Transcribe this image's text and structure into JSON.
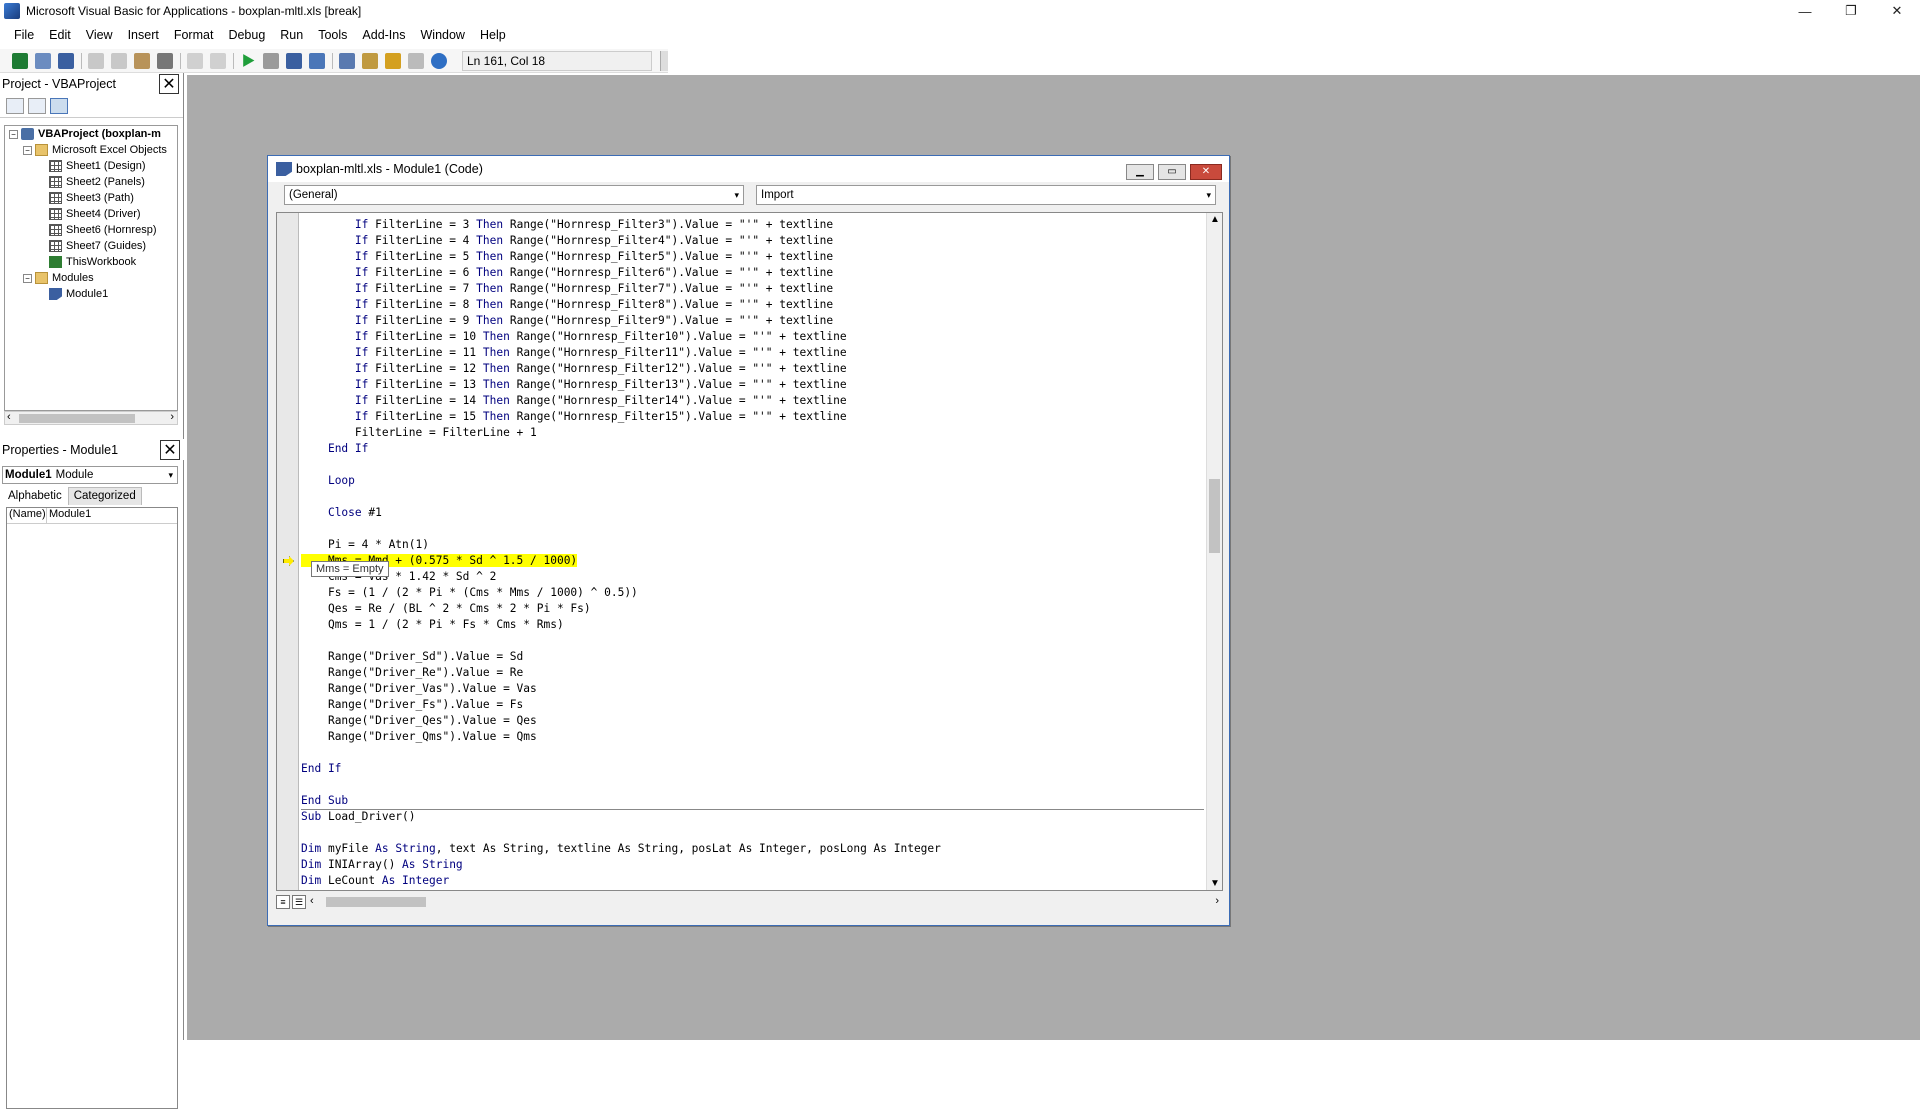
{
  "app": {
    "title": "Microsoft Visual Basic for Applications - boxplan-mltl.xls [break]",
    "window_controls": [
      "—",
      "❐",
      "✕"
    ]
  },
  "menu": [
    "File",
    "Edit",
    "View",
    "Insert",
    "Format",
    "Debug",
    "Run",
    "Tools",
    "Add-Ins",
    "Window",
    "Help"
  ],
  "toolbar": {
    "position_text": "Ln 161, Col 18"
  },
  "project": {
    "header": "Project - VBAProject",
    "close": "✕",
    "tree": [
      {
        "label": "VBAProject (boxplan-m",
        "level": 0,
        "toggle": "−",
        "icon": "project-icon",
        "bold": true
      },
      {
        "label": "Microsoft Excel Objects",
        "level": 1,
        "toggle": "−",
        "icon": "folder-icon"
      },
      {
        "label": "Sheet1 (Design)",
        "level": 2,
        "icon": "sheet-icon"
      },
      {
        "label": "Sheet2 (Panels)",
        "level": 2,
        "icon": "sheet-icon"
      },
      {
        "label": "Sheet3 (Path)",
        "level": 2,
        "icon": "sheet-icon"
      },
      {
        "label": "Sheet4 (Driver)",
        "level": 2,
        "icon": "sheet-icon"
      },
      {
        "label": "Sheet6 (Hornresp)",
        "level": 2,
        "icon": "sheet-icon"
      },
      {
        "label": "Sheet7 (Guides)",
        "level": 2,
        "icon": "sheet-icon"
      },
      {
        "label": "ThisWorkbook",
        "level": 2,
        "icon": "workbook-icon"
      },
      {
        "label": "Modules",
        "level": 1,
        "toggle": "−",
        "icon": "folder-icon"
      },
      {
        "label": "Module1",
        "level": 2,
        "icon": "module-icon"
      }
    ]
  },
  "properties": {
    "header": "Properties - Module1",
    "close": "✕",
    "select_name": "Module1",
    "select_type": "Module",
    "tabs": [
      "Alphabetic",
      "Categorized"
    ],
    "rows": [
      {
        "name": "(Name)",
        "value": "Module1"
      }
    ]
  },
  "codewindow": {
    "title": "boxplan-mltl.xls - Module1 (Code)",
    "object_combo": "(General)",
    "proc_combo": "Import",
    "tooltip": "Mms = Empty",
    "lines": [
      {
        "indent": "        ",
        "kw1": "If",
        "mid": " FilterLine = 3 ",
        "kw2": "Then",
        "rest": " Range(\"Hornresp_Filter3\").Value = \"'\" + textline"
      },
      {
        "indent": "        ",
        "kw1": "If",
        "mid": " FilterLine = 4 ",
        "kw2": "Then",
        "rest": " Range(\"Hornresp_Filter4\").Value = \"'\" + textline"
      },
      {
        "indent": "        ",
        "kw1": "If",
        "mid": " FilterLine = 5 ",
        "kw2": "Then",
        "rest": " Range(\"Hornresp_Filter5\").Value = \"'\" + textline"
      },
      {
        "indent": "        ",
        "kw1": "If",
        "mid": " FilterLine = 6 ",
        "kw2": "Then",
        "rest": " Range(\"Hornresp_Filter6\").Value = \"'\" + textline"
      },
      {
        "indent": "        ",
        "kw1": "If",
        "mid": " FilterLine = 7 ",
        "kw2": "Then",
        "rest": " Range(\"Hornresp_Filter7\").Value = \"'\" + textline"
      },
      {
        "indent": "        ",
        "kw1": "If",
        "mid": " FilterLine = 8 ",
        "kw2": "Then",
        "rest": " Range(\"Hornresp_Filter8\").Value = \"'\" + textline"
      },
      {
        "indent": "        ",
        "kw1": "If",
        "mid": " FilterLine = 9 ",
        "kw2": "Then",
        "rest": " Range(\"Hornresp_Filter9\").Value = \"'\" + textline"
      },
      {
        "indent": "        ",
        "kw1": "If",
        "mid": " FilterLine = 10 ",
        "kw2": "Then",
        "rest": " Range(\"Hornresp_Filter10\").Value = \"'\" + textline"
      },
      {
        "indent": "        ",
        "kw1": "If",
        "mid": " FilterLine = 11 ",
        "kw2": "Then",
        "rest": " Range(\"Hornresp_Filter11\").Value = \"'\" + textline"
      },
      {
        "indent": "        ",
        "kw1": "If",
        "mid": " FilterLine = 12 ",
        "kw2": "Then",
        "rest": " Range(\"Hornresp_Filter12\").Value = \"'\" + textline"
      },
      {
        "indent": "        ",
        "kw1": "If",
        "mid": " FilterLine = 13 ",
        "kw2": "Then",
        "rest": " Range(\"Hornresp_Filter13\").Value = \"'\" + textline"
      },
      {
        "indent": "        ",
        "kw1": "If",
        "mid": " FilterLine = 14 ",
        "kw2": "Then",
        "rest": " Range(\"Hornresp_Filter14\").Value = \"'\" + textline"
      },
      {
        "indent": "        ",
        "kw1": "If",
        "mid": " FilterLine = 15 ",
        "kw2": "Then",
        "rest": " Range(\"Hornresp_Filter15\").Value = \"'\" + textline"
      },
      {
        "indent": "        ",
        "kw1": "",
        "mid": "FilterLine = FilterLine + 1",
        "kw2": "",
        "rest": ""
      },
      {
        "indent": "    ",
        "kw1": "End If",
        "mid": "",
        "kw2": "",
        "rest": ""
      },
      {
        "indent": "",
        "kw1": "",
        "mid": "",
        "kw2": "",
        "rest": ""
      },
      {
        "indent": "    ",
        "kw1": "Loop",
        "mid": "",
        "kw2": "",
        "rest": ""
      },
      {
        "indent": "",
        "kw1": "",
        "mid": "",
        "kw2": "",
        "rest": ""
      },
      {
        "indent": "    ",
        "kw1": "Close",
        "mid": " #1",
        "kw2": "",
        "rest": ""
      },
      {
        "indent": "",
        "kw1": "",
        "mid": "",
        "kw2": "",
        "rest": ""
      },
      {
        "indent": "    ",
        "kw1": "",
        "mid": "Pi = 4 * Atn(1)",
        "kw2": "",
        "rest": ""
      },
      {
        "indent": "    ",
        "kw1": "",
        "mid": "Mms = Mmd + (0.575 * Sd ^ 1.5 / 1000)",
        "kw2": "",
        "rest": "",
        "highlight": true
      },
      {
        "indent": "    ",
        "kw1": "",
        "mid": "Cms = Vas * 1.42 * Sd ^ 2",
        "kw2": "",
        "rest": ""
      },
      {
        "indent": "    ",
        "kw1": "",
        "mid": "Fs = (1 / (2 * Pi * (Cms * Mms / 1000) ^ 0.5))",
        "kw2": "",
        "rest": ""
      },
      {
        "indent": "    ",
        "kw1": "",
        "mid": "Qes = Re / (BL ^ 2 * Cms * 2 * Pi * Fs)",
        "kw2": "",
        "rest": ""
      },
      {
        "indent": "    ",
        "kw1": "",
        "mid": "Qms = 1 / (2 * Pi * Fs * Cms * Rms)",
        "kw2": "",
        "rest": ""
      },
      {
        "indent": "",
        "kw1": "",
        "mid": "",
        "kw2": "",
        "rest": ""
      },
      {
        "indent": "    ",
        "kw1": "",
        "mid": "Range(\"Driver_Sd\").Value = Sd",
        "kw2": "",
        "rest": ""
      },
      {
        "indent": "    ",
        "kw1": "",
        "mid": "Range(\"Driver_Re\").Value = Re",
        "kw2": "",
        "rest": ""
      },
      {
        "indent": "    ",
        "kw1": "",
        "mid": "Range(\"Driver_Vas\").Value = Vas",
        "kw2": "",
        "rest": ""
      },
      {
        "indent": "    ",
        "kw1": "",
        "mid": "Range(\"Driver_Fs\").Value = Fs",
        "kw2": "",
        "rest": ""
      },
      {
        "indent": "    ",
        "kw1": "",
        "mid": "Range(\"Driver_Qes\").Value = Qes",
        "kw2": "",
        "rest": ""
      },
      {
        "indent": "    ",
        "kw1": "",
        "mid": "Range(\"Driver_Qms\").Value = Qms",
        "kw2": "",
        "rest": ""
      },
      {
        "indent": "",
        "kw1": "",
        "mid": "",
        "kw2": "",
        "rest": ""
      },
      {
        "indent": "",
        "kw1": "End If",
        "mid": "",
        "kw2": "",
        "rest": ""
      },
      {
        "indent": "",
        "kw1": "",
        "mid": "",
        "kw2": "",
        "rest": ""
      },
      {
        "indent": "",
        "kw1": "End Sub",
        "mid": "",
        "kw2": "",
        "rest": ""
      },
      {
        "indent": "",
        "kw1": "Sub",
        "mid": " Load_Driver()",
        "kw2": "",
        "rest": "",
        "separator_before": true
      },
      {
        "indent": "",
        "kw1": "",
        "mid": "",
        "kw2": "",
        "rest": ""
      },
      {
        "indent": "",
        "kw1": "Dim",
        "mid": " myFile ",
        "kw2": "As String",
        "rest": ", text As String, textline As String, posLat As Integer, posLong As Integer"
      },
      {
        "indent": "",
        "kw1": "Dim",
        "mid": " INIArray() ",
        "kw2": "As String",
        "rest": ""
      },
      {
        "indent": "",
        "kw1": "Dim",
        "mid": " LeCount ",
        "kw2": "As Integer",
        "rest": ""
      }
    ]
  }
}
